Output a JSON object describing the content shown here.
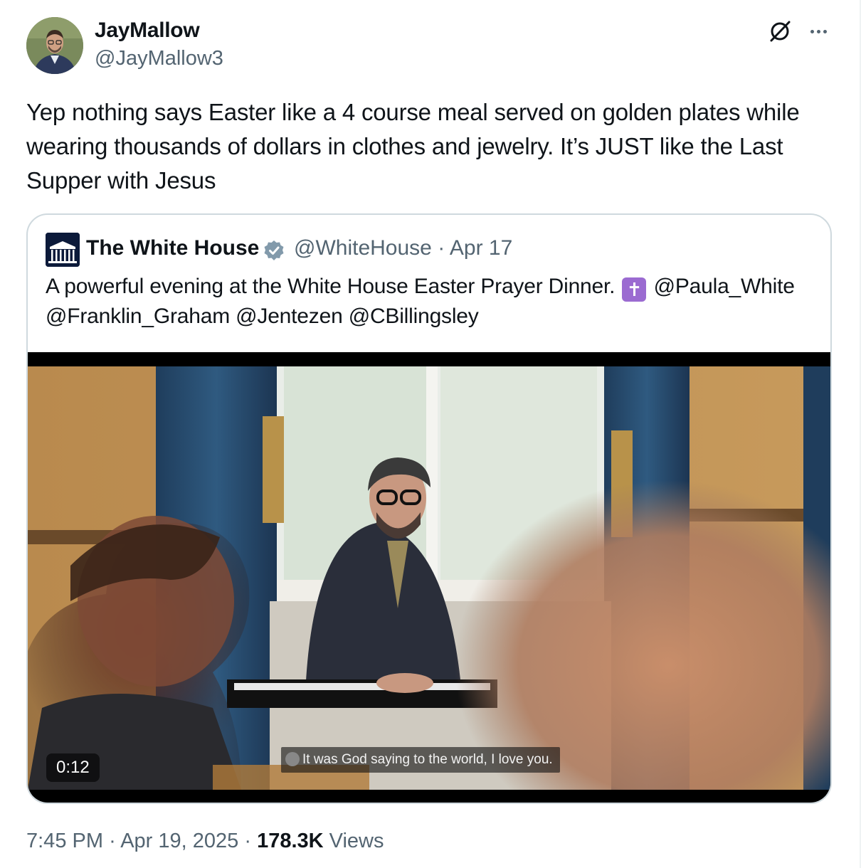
{
  "author": {
    "name": "JayMallow",
    "handle": "@JayMallow3"
  },
  "icons": {
    "grok": "grok-icon",
    "more": "more-icon",
    "verified": "verified-badge-icon"
  },
  "tweet": {
    "text": "Yep nothing says Easter like a 4 course meal served on golden plates while wearing thousands of dollars in clothes and jewelry. It’s JUST like the Last Supper with Jesus"
  },
  "quote": {
    "name": "The White House",
    "handle": "@WhiteHouse",
    "separator": "·",
    "date": "Apr 17",
    "text_before": "A powerful evening at the White House Easter Prayer Dinner.",
    "emoji": "✝",
    "text_after": "@Paula_White @Franklin_Graham @Jentezen @CBillingsley",
    "video": {
      "caption": "It was God saying to the world, I love you.",
      "duration": "0:12"
    }
  },
  "meta": {
    "time": "7:45 PM",
    "separator": "·",
    "date": "Apr 19, 2025",
    "views_count": "178.3K",
    "views_label": "Views"
  },
  "colors": {
    "text": "#0f1419",
    "secondary": "#536471",
    "border": "#cfd9de",
    "verified": "#829aab",
    "emoji_bg": "#9b6bd1"
  }
}
